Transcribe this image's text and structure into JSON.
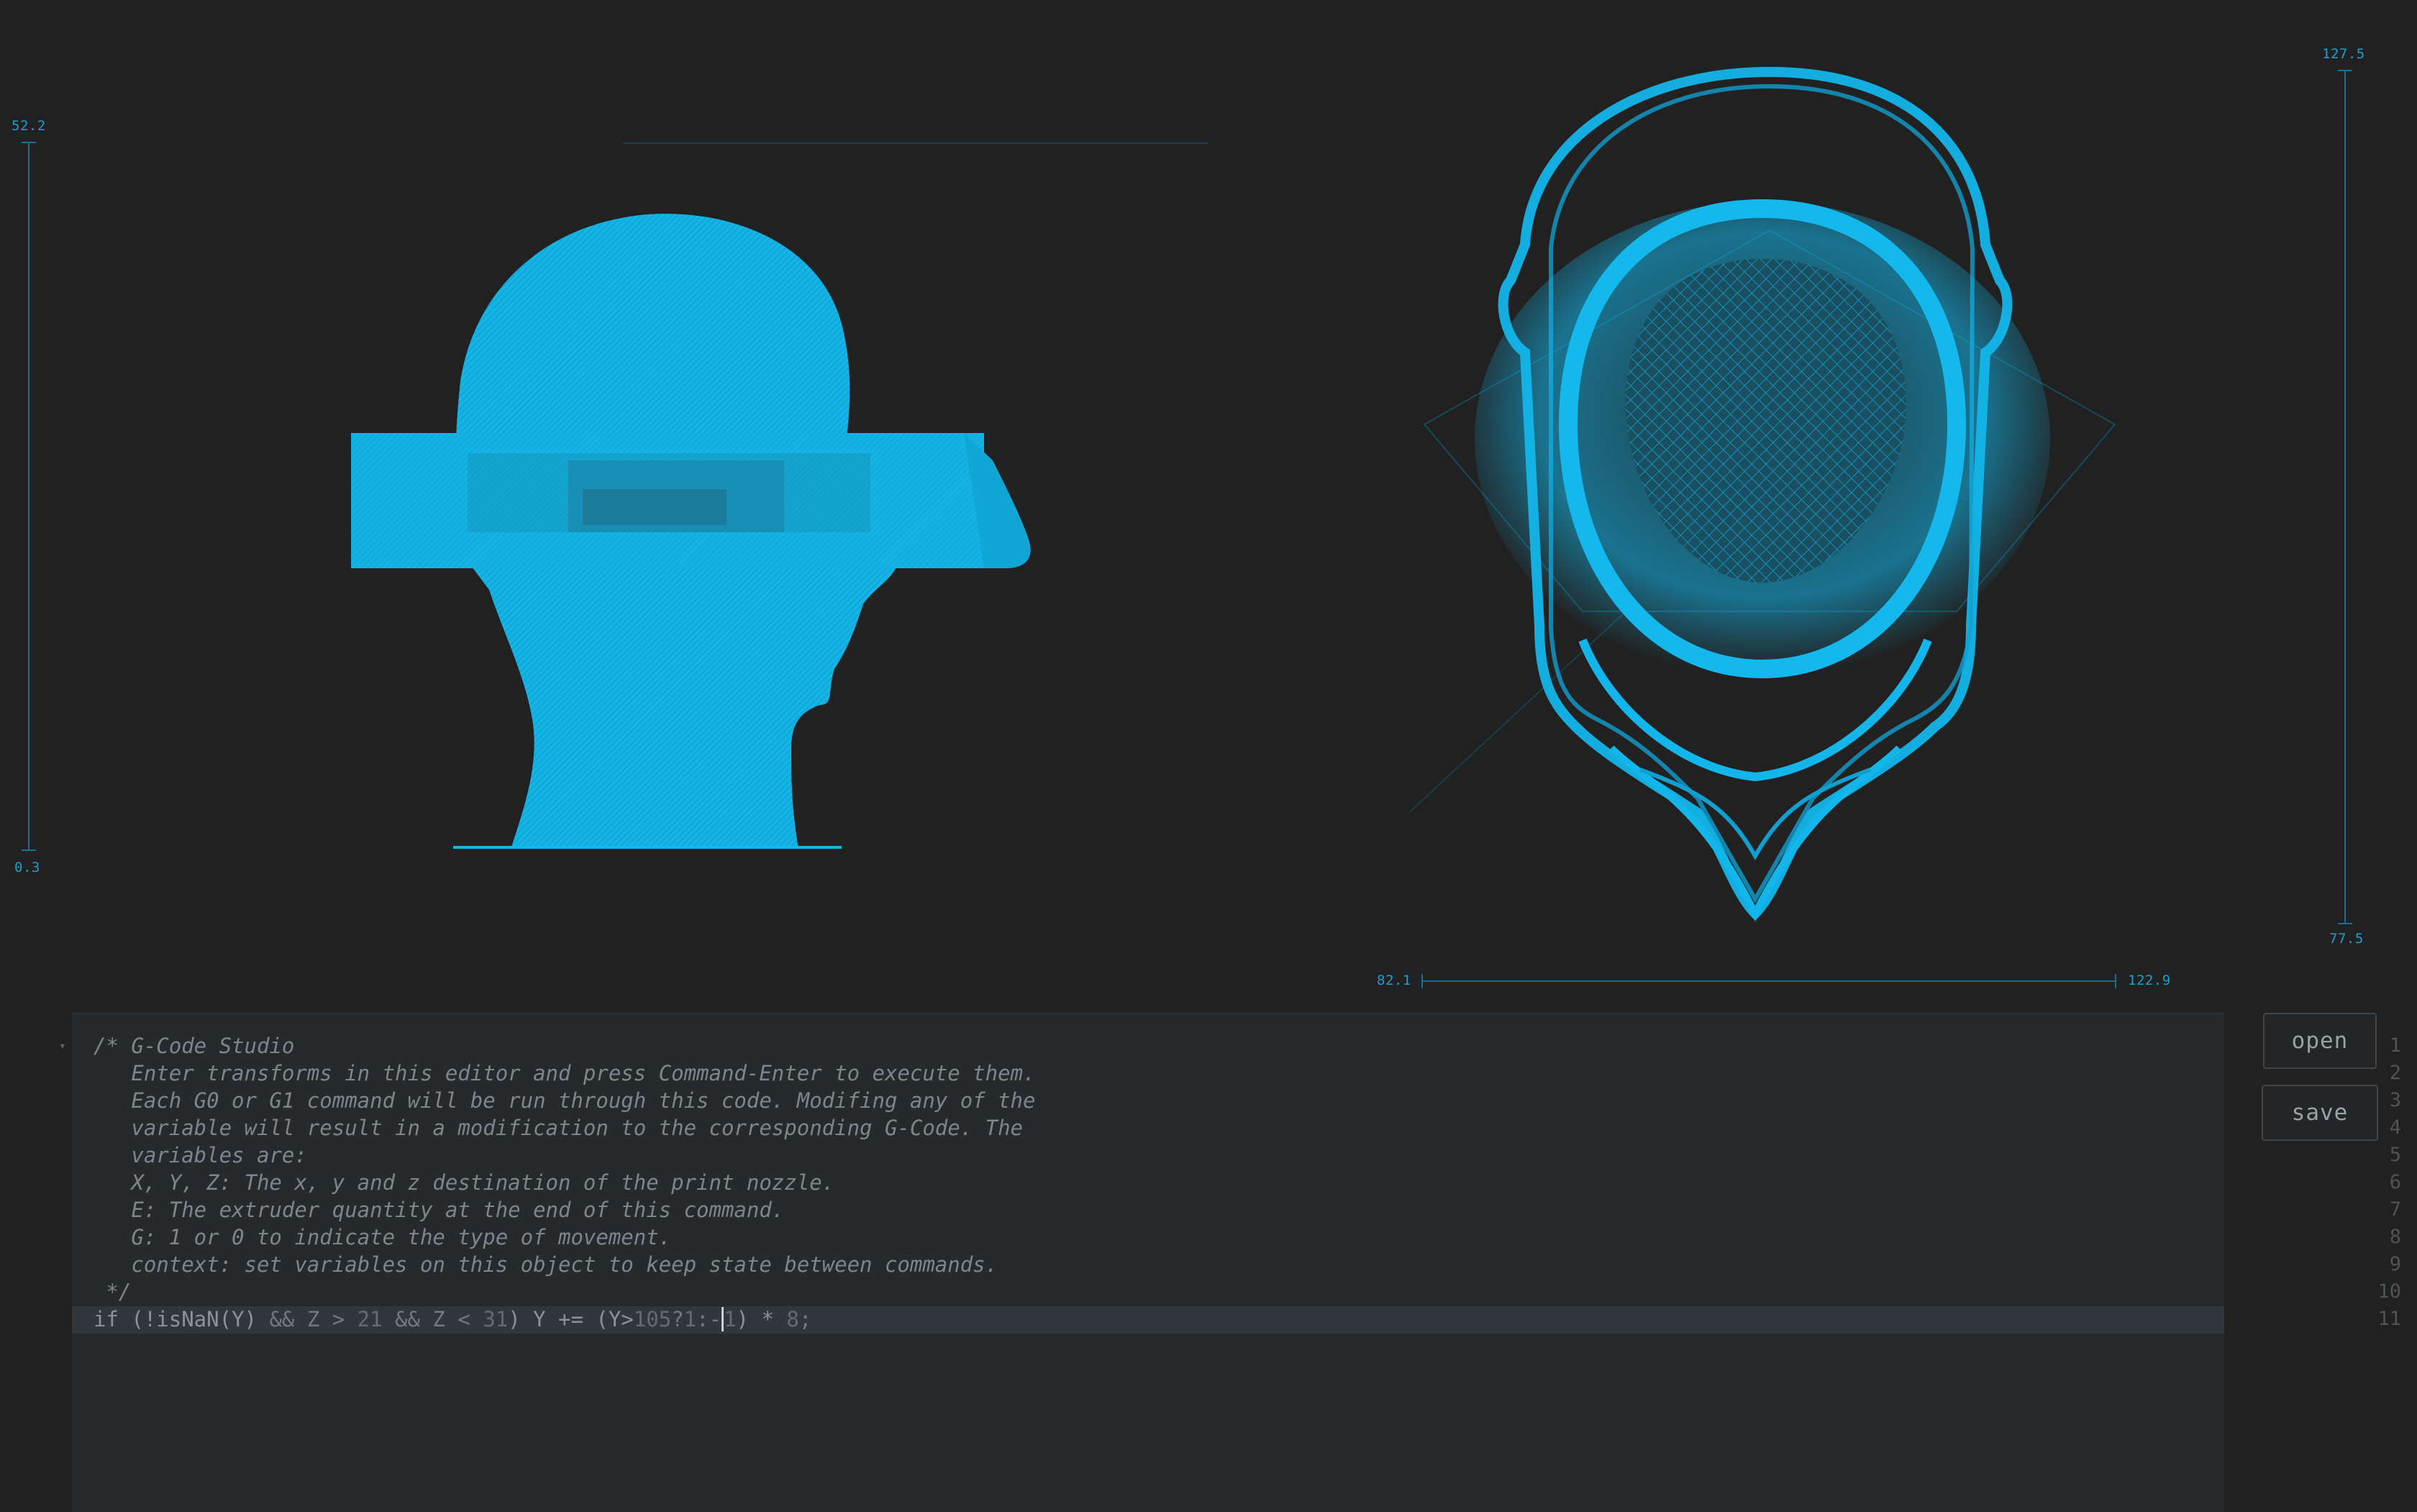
{
  "side_view": {
    "z_max_label": "52.2",
    "z_min_label": "0.3"
  },
  "top_view": {
    "y_max_label": "127.5",
    "y_min_label": "77.5",
    "x_min_label": "82.1",
    "x_max_label": "122.9"
  },
  "colors": {
    "background": "#212121",
    "model": "#12b8ec",
    "scale": "#1f9fcf",
    "editor_bg": "#262a2d"
  },
  "editor": {
    "line_numbers": [
      "1",
      "2",
      "3",
      "4",
      "5",
      "6",
      "7",
      "8",
      "9",
      "10",
      "11"
    ],
    "comment_lines": [
      "/* G-Code Studio",
      "   Enter transforms in this editor and press Command-Enter to execute them.",
      "   Each G0 or G1 command will be run through this code. Modifing any of the",
      "   variable will result in a modification to the corresponding G-Code. The",
      "   variables are:",
      "   X, Y, Z: The x, y and z destination of the print nozzle.",
      "   E: The extruder quantity at the end of this command.",
      "   G: 1 or 0 to indicate the type of movement.",
      "   context: set variables on this object to keep state between commands.",
      " */"
    ],
    "code_line": {
      "part1": "if (",
      "part2": "!isNaN(Y)",
      "part3": " && Z > ",
      "part4": "21",
      "part5": " && Z < ",
      "part6": "31",
      "part7": ") Y += (Y>",
      "part8": "105",
      "part9": "?",
      "part10": "1",
      "part11": ":-",
      "part12": "1",
      "part13": ") * ",
      "part14": "8",
      "part15": ";"
    }
  },
  "buttons": {
    "open_label": "open",
    "save_label": "save"
  }
}
